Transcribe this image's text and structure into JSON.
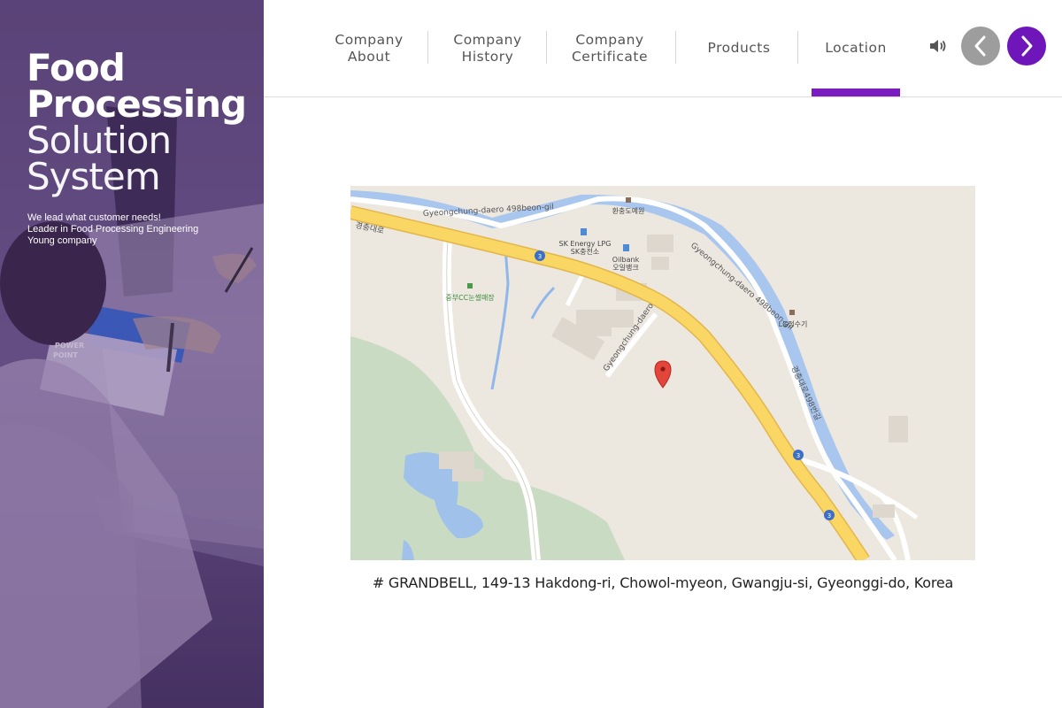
{
  "hero": {
    "title_line1": "Food",
    "title_line2": "Processing",
    "title_line3": "Solution",
    "title_line4": "System",
    "tagline_line1": "We lead what customer needs!",
    "tagline_line2": "Leader in Food Processing Engineering",
    "tagline_line3": "Young company",
    "photo_text_line1": "POWER",
    "photo_text_line2": "POINT"
  },
  "nav": {
    "items": [
      {
        "line1": "Company",
        "line2": "About"
      },
      {
        "line1": "Company",
        "line2": "History"
      },
      {
        "line1": "Company",
        "line2": "Certificate"
      },
      {
        "line1": "Products",
        "line2": ""
      },
      {
        "line1": "Location",
        "line2": ""
      }
    ],
    "active_index": 4,
    "accent_color": "#6f16ba",
    "prev_button_color": "#9d9d9d"
  },
  "map": {
    "road_labels": {
      "gil_top": "Gyeongchung-daero 498beon-gil",
      "gil_right": "Gyeongchung-daero 498beon-gil",
      "daero": "Gyeongchung-daero",
      "korean_daero": "경충대로",
      "korean_right": "경충대로498번길"
    },
    "places": {
      "hwanchung": "환충도예원",
      "sk_en": "SK Energy LPG",
      "sk_ko": "SK충전소",
      "oil_en": "Oilbank",
      "oil_ko": "오일뱅크",
      "cc": "중부CC눈썰매장",
      "lg": "LG정수기"
    },
    "route_badges": [
      "3",
      "3",
      "3"
    ]
  },
  "address": "# GRANDBELL, 149-13 Hakdong-ri, Chowol-myeon, Gwangju-si, Gyeonggi-do, Korea"
}
